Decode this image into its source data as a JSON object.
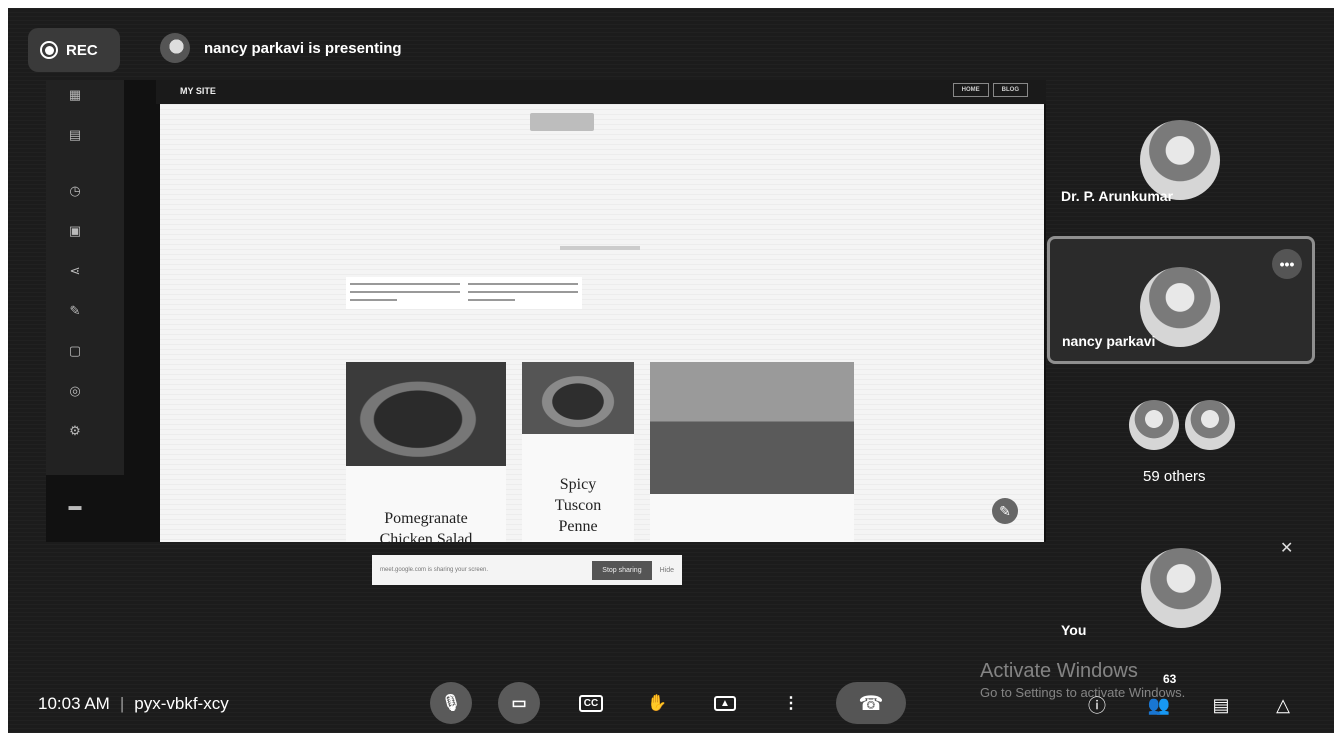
{
  "recording": {
    "label": "REC"
  },
  "presenter_banner": {
    "text": "nancy parkavi is presenting"
  },
  "shared_screen": {
    "site_title": "MY SITE",
    "nav_links": [
      "HOME",
      "BLOG"
    ],
    "dishes": [
      {
        "title": "Pomegranate Chicken Salad"
      },
      {
        "title": "Spicy Tuscon Penne"
      }
    ],
    "sharing_bar": {
      "message": "meet.google.com is sharing your screen.",
      "stop_label": "Stop sharing",
      "hide_label": "Hide"
    }
  },
  "participants": {
    "tiles": [
      {
        "name": "Dr. P. Arunkumar"
      },
      {
        "name": "nancy parkavi"
      }
    ],
    "others": {
      "label": "59 others"
    },
    "self": {
      "name": "You"
    }
  },
  "meeting": {
    "time": "10:03 AM",
    "separator": "|",
    "code": "pyx-vbkf-xcy"
  },
  "controls": {
    "mic": "mic-off-icon",
    "camera": "camera-off-icon",
    "captions": "CC",
    "raise_hand": "hand-icon",
    "present": "present-icon",
    "more": "more-vert-icon",
    "hangup": "hangup-icon"
  },
  "side_controls": {
    "people_count": "63"
  },
  "watermark": {
    "line1": "Activate Windows",
    "line2": "Go to Settings to activate Windows."
  }
}
